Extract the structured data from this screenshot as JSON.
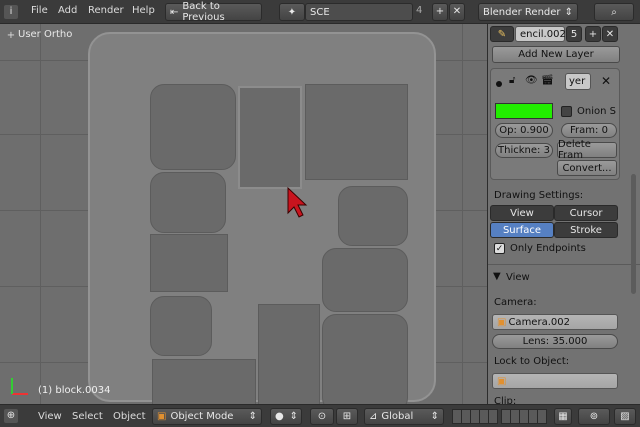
{
  "topbar": {
    "menus": [
      "File",
      "Add",
      "Render",
      "Help"
    ],
    "back_label": "Back to Previous",
    "scene_name": "SCE",
    "scene_users": "4",
    "engine": "Blender Render"
  },
  "viewport": {
    "view_label": "User Ortho",
    "object_label": "(1) block.0034"
  },
  "panel": {
    "datablock_name": "encil.002",
    "datablock_users": "5",
    "add_layer": "Add New Layer",
    "layer_name": "yer",
    "layer_color": "#22ee00",
    "onion": "Onion S",
    "opacity": "Op: 0.900",
    "frame": "Fram: 0",
    "thickness": "Thickne: 3",
    "delete_frame": "Delete Fram",
    "convert": "Convert...",
    "drawing_settings": "Drawing Settings:",
    "draw_view": "View",
    "draw_cursor": "Cursor",
    "draw_surface": "Surface",
    "draw_stroke": "Stroke",
    "only_endpoints": "Only Endpoints",
    "view_section": "View",
    "camera_label": "Camera:",
    "camera_value": "Camera.002",
    "lens": "Lens: 35.000",
    "lock_label": "Lock to Object:",
    "clip_label": "Clip:"
  },
  "bottombar": {
    "menus": [
      "View",
      "Select",
      "Object"
    ],
    "mode": "Object Mode",
    "orientation": "Global"
  }
}
